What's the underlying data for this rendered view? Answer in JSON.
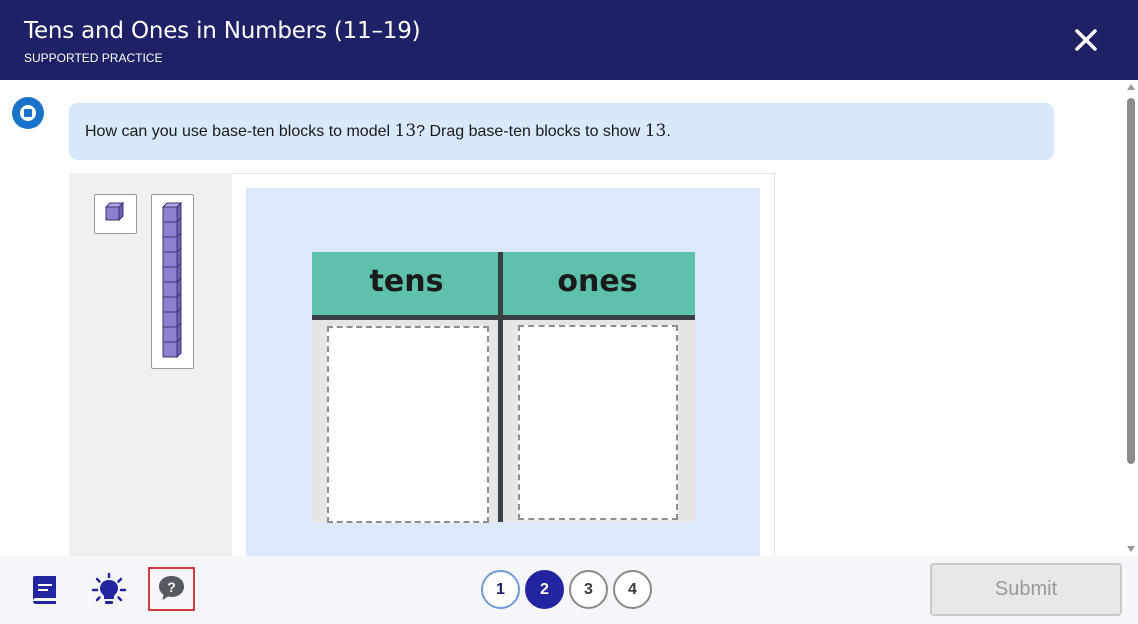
{
  "header": {
    "title": "Tens and Ones in Numbers (11–19)",
    "subtitle": "SUPPORTED PRACTICE",
    "close_icon": "close-icon"
  },
  "question": {
    "text_a": "How can you use base-ten blocks to model ",
    "number_a": "13",
    "text_b": "? Drag base-ten blocks to show ",
    "number_b": "13",
    "text_c": "."
  },
  "tray": {
    "items": [
      {
        "name": "one-cube",
        "icon": "unit-cube-icon"
      },
      {
        "name": "ten-rod",
        "icon": "ten-rod-icon"
      }
    ]
  },
  "place_value_chart": {
    "tens_label": "tens",
    "ones_label": "ones"
  },
  "footer": {
    "tools": [
      {
        "icon": "book-icon"
      },
      {
        "icon": "lightbulb-icon"
      },
      {
        "icon": "help-chat-icon"
      }
    ],
    "steps": [
      {
        "label": "1",
        "state": "visited"
      },
      {
        "label": "2",
        "state": "current"
      },
      {
        "label": "3",
        "state": "todo"
      },
      {
        "label": "4",
        "state": "todo"
      }
    ],
    "submit_label": "Submit"
  },
  "colors": {
    "header_bg": "#1e2166",
    "question_bg": "#d8e9fb",
    "workspace_bg": "#dce9fb",
    "chart_header": "#5dc1ab",
    "block_purple": "#8e7fd0",
    "accent_blue": "#2224a0"
  }
}
